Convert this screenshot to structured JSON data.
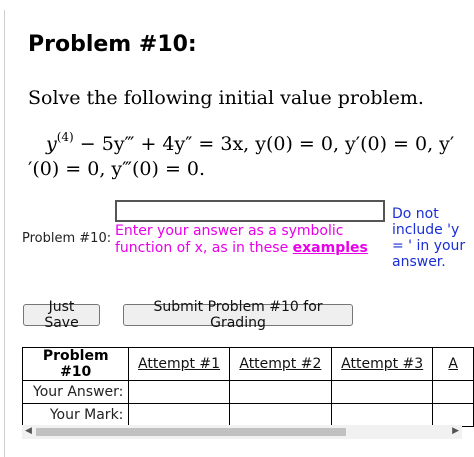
{
  "problem": {
    "title": "Problem #10:",
    "prompt": "Solve the following initial value problem.",
    "equation": {
      "line1_parts": [
        "y",
        "(4)",
        " − 5y‴ + 4y″ = 3x,   y(0) = 0, y′(0) = 0, y′"
      ],
      "line2": "′(0) = 0, y‴(0) = 0."
    },
    "label": "Problem #10:",
    "answer_value": "",
    "hint_text": "Enter your answer as a symbolic function of x, as in these",
    "hint_link": "examples",
    "side_note": "Do not include 'y = ' in your answer."
  },
  "buttons": {
    "just_save": "Just Save",
    "submit": "Submit Problem #10 for Grading"
  },
  "attempts_table": {
    "header": "Problem #10",
    "columns": [
      "Attempt #1",
      "Attempt #2",
      "Attempt #3",
      "A"
    ],
    "rows": [
      "Your Answer:",
      "Your Mark:"
    ]
  },
  "scrollbar": {
    "left_arrow_icon": "chevron-left-icon",
    "right_arrow_icon": "chevron-right-icon"
  }
}
